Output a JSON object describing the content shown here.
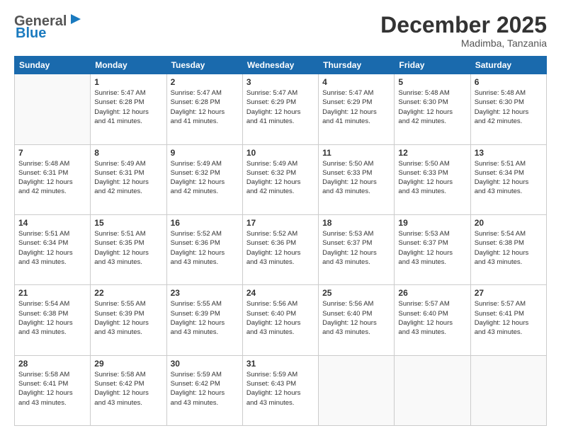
{
  "logo": {
    "general": "General",
    "blue": "Blue"
  },
  "title": "December 2025",
  "location": "Madimba, Tanzania",
  "headers": [
    "Sunday",
    "Monday",
    "Tuesday",
    "Wednesday",
    "Thursday",
    "Friday",
    "Saturday"
  ],
  "weeks": [
    [
      {
        "day": "",
        "info": ""
      },
      {
        "day": "1",
        "info": "Sunrise: 5:47 AM\nSunset: 6:28 PM\nDaylight: 12 hours\nand 41 minutes."
      },
      {
        "day": "2",
        "info": "Sunrise: 5:47 AM\nSunset: 6:28 PM\nDaylight: 12 hours\nand 41 minutes."
      },
      {
        "day": "3",
        "info": "Sunrise: 5:47 AM\nSunset: 6:29 PM\nDaylight: 12 hours\nand 41 minutes."
      },
      {
        "day": "4",
        "info": "Sunrise: 5:47 AM\nSunset: 6:29 PM\nDaylight: 12 hours\nand 41 minutes."
      },
      {
        "day": "5",
        "info": "Sunrise: 5:48 AM\nSunset: 6:30 PM\nDaylight: 12 hours\nand 42 minutes."
      },
      {
        "day": "6",
        "info": "Sunrise: 5:48 AM\nSunset: 6:30 PM\nDaylight: 12 hours\nand 42 minutes."
      }
    ],
    [
      {
        "day": "7",
        "info": "Sunrise: 5:48 AM\nSunset: 6:31 PM\nDaylight: 12 hours\nand 42 minutes."
      },
      {
        "day": "8",
        "info": "Sunrise: 5:49 AM\nSunset: 6:31 PM\nDaylight: 12 hours\nand 42 minutes."
      },
      {
        "day": "9",
        "info": "Sunrise: 5:49 AM\nSunset: 6:32 PM\nDaylight: 12 hours\nand 42 minutes."
      },
      {
        "day": "10",
        "info": "Sunrise: 5:49 AM\nSunset: 6:32 PM\nDaylight: 12 hours\nand 42 minutes."
      },
      {
        "day": "11",
        "info": "Sunrise: 5:50 AM\nSunset: 6:33 PM\nDaylight: 12 hours\nand 43 minutes."
      },
      {
        "day": "12",
        "info": "Sunrise: 5:50 AM\nSunset: 6:33 PM\nDaylight: 12 hours\nand 43 minutes."
      },
      {
        "day": "13",
        "info": "Sunrise: 5:51 AM\nSunset: 6:34 PM\nDaylight: 12 hours\nand 43 minutes."
      }
    ],
    [
      {
        "day": "14",
        "info": "Sunrise: 5:51 AM\nSunset: 6:34 PM\nDaylight: 12 hours\nand 43 minutes."
      },
      {
        "day": "15",
        "info": "Sunrise: 5:51 AM\nSunset: 6:35 PM\nDaylight: 12 hours\nand 43 minutes."
      },
      {
        "day": "16",
        "info": "Sunrise: 5:52 AM\nSunset: 6:36 PM\nDaylight: 12 hours\nand 43 minutes."
      },
      {
        "day": "17",
        "info": "Sunrise: 5:52 AM\nSunset: 6:36 PM\nDaylight: 12 hours\nand 43 minutes."
      },
      {
        "day": "18",
        "info": "Sunrise: 5:53 AM\nSunset: 6:37 PM\nDaylight: 12 hours\nand 43 minutes."
      },
      {
        "day": "19",
        "info": "Sunrise: 5:53 AM\nSunset: 6:37 PM\nDaylight: 12 hours\nand 43 minutes."
      },
      {
        "day": "20",
        "info": "Sunrise: 5:54 AM\nSunset: 6:38 PM\nDaylight: 12 hours\nand 43 minutes."
      }
    ],
    [
      {
        "day": "21",
        "info": "Sunrise: 5:54 AM\nSunset: 6:38 PM\nDaylight: 12 hours\nand 43 minutes."
      },
      {
        "day": "22",
        "info": "Sunrise: 5:55 AM\nSunset: 6:39 PM\nDaylight: 12 hours\nand 43 minutes."
      },
      {
        "day": "23",
        "info": "Sunrise: 5:55 AM\nSunset: 6:39 PM\nDaylight: 12 hours\nand 43 minutes."
      },
      {
        "day": "24",
        "info": "Sunrise: 5:56 AM\nSunset: 6:40 PM\nDaylight: 12 hours\nand 43 minutes."
      },
      {
        "day": "25",
        "info": "Sunrise: 5:56 AM\nSunset: 6:40 PM\nDaylight: 12 hours\nand 43 minutes."
      },
      {
        "day": "26",
        "info": "Sunrise: 5:57 AM\nSunset: 6:40 PM\nDaylight: 12 hours\nand 43 minutes."
      },
      {
        "day": "27",
        "info": "Sunrise: 5:57 AM\nSunset: 6:41 PM\nDaylight: 12 hours\nand 43 minutes."
      }
    ],
    [
      {
        "day": "28",
        "info": "Sunrise: 5:58 AM\nSunset: 6:41 PM\nDaylight: 12 hours\nand 43 minutes."
      },
      {
        "day": "29",
        "info": "Sunrise: 5:58 AM\nSunset: 6:42 PM\nDaylight: 12 hours\nand 43 minutes."
      },
      {
        "day": "30",
        "info": "Sunrise: 5:59 AM\nSunset: 6:42 PM\nDaylight: 12 hours\nand 43 minutes."
      },
      {
        "day": "31",
        "info": "Sunrise: 5:59 AM\nSunset: 6:43 PM\nDaylight: 12 hours\nand 43 minutes."
      },
      {
        "day": "",
        "info": ""
      },
      {
        "day": "",
        "info": ""
      },
      {
        "day": "",
        "info": ""
      }
    ]
  ]
}
